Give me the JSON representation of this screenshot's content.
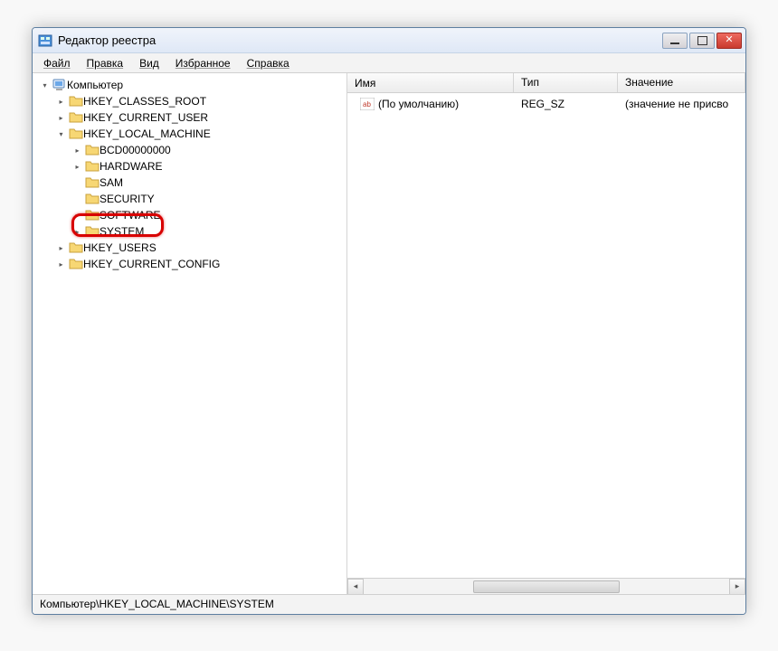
{
  "window": {
    "title": "Редактор реестра"
  },
  "menu": {
    "file": "Файл",
    "edit": "Правка",
    "view": "Вид",
    "favorites": "Избранное",
    "help": "Справка"
  },
  "tree": {
    "root": "Компьютер",
    "hkcr": "HKEY_CLASSES_ROOT",
    "hkcu": "HKEY_CURRENT_USER",
    "hklm": "HKEY_LOCAL_MACHINE",
    "hklm_children": {
      "bcd": "BCD00000000",
      "hardware": "HARDWARE",
      "sam": "SAM",
      "security": "SECURITY",
      "software": "SOFTWARE",
      "system": "SYSTEM"
    },
    "hku": "HKEY_USERS",
    "hkcc": "HKEY_CURRENT_CONFIG"
  },
  "list": {
    "col_name": "Имя",
    "col_type": "Тип",
    "col_value": "Значение",
    "rows": [
      {
        "name": "(По умолчанию)",
        "type": "REG_SZ",
        "value": "(значение не присво"
      }
    ]
  },
  "statusbar": {
    "path": "Компьютер\\HKEY_LOCAL_MACHINE\\SYSTEM"
  }
}
